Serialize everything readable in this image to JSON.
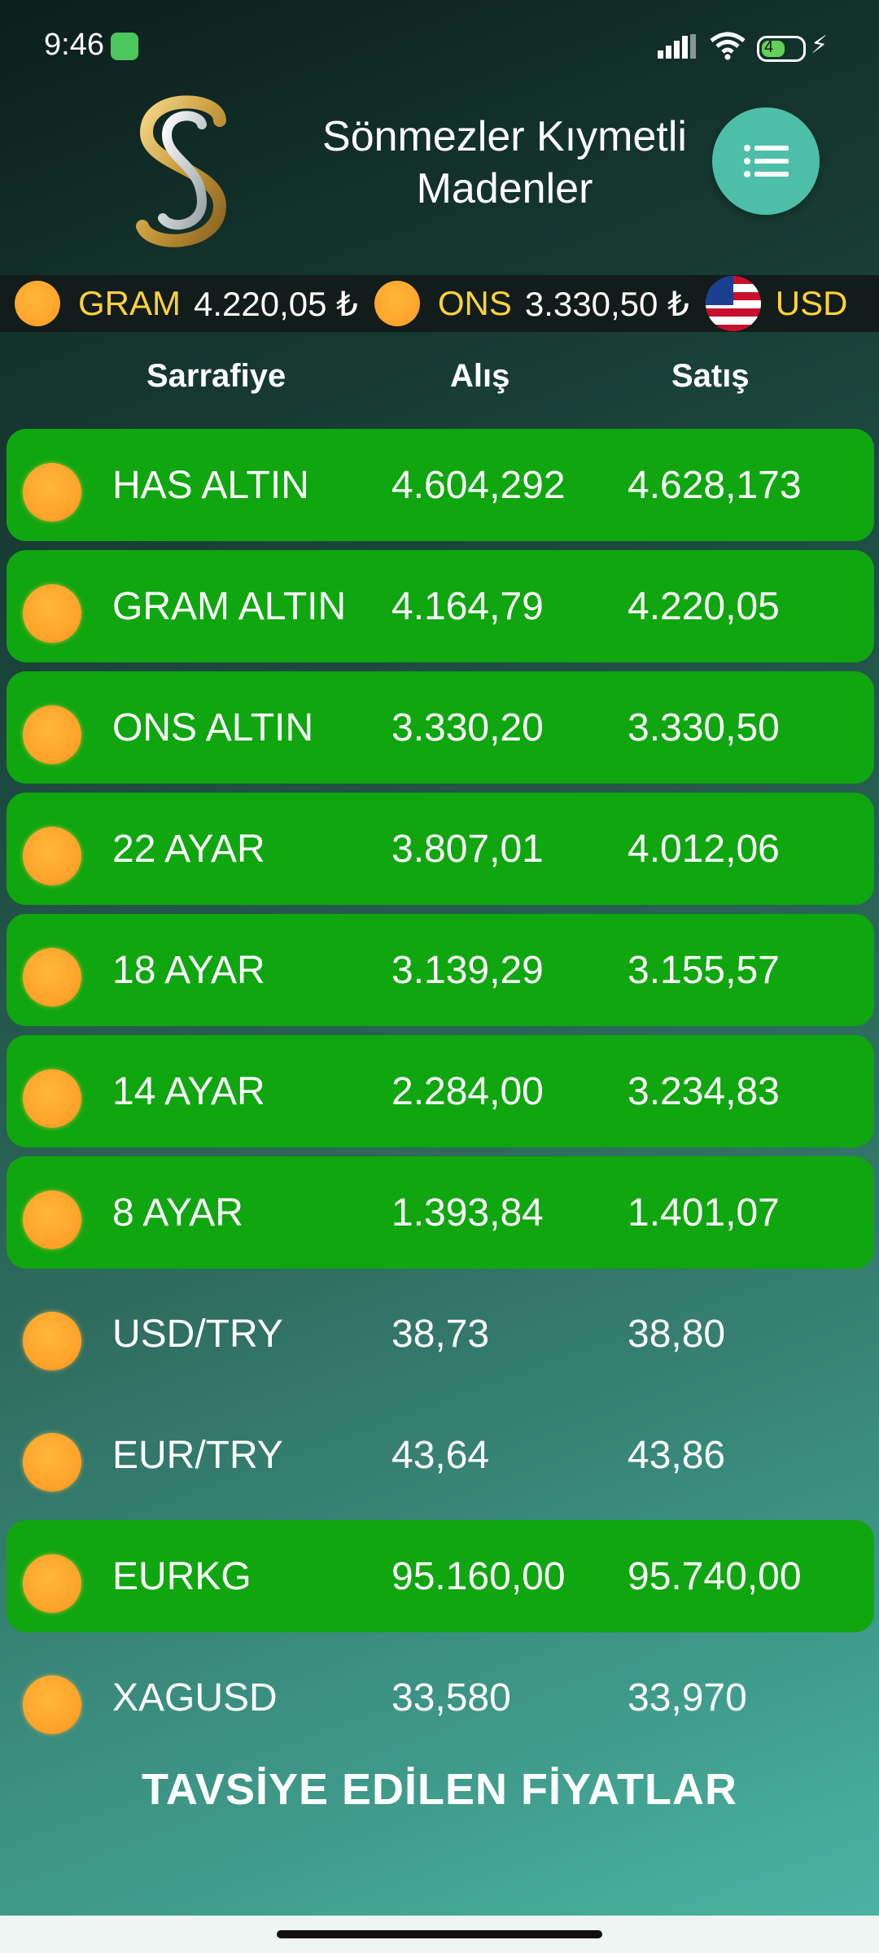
{
  "status_bar": {
    "time": "9:46",
    "battery": "4"
  },
  "header": {
    "title_line1": "Sönmezler Kıymetli",
    "title_line2": "Madenler",
    "menu_icon": "list-icon"
  },
  "ticker": {
    "items": [
      {
        "name": "GRAM",
        "value": "4.220,05 ₺"
      },
      {
        "name": "ONS",
        "value": "3.330,50 ₺"
      },
      {
        "name": "USD",
        "value": ""
      }
    ]
  },
  "table": {
    "headers": {
      "name": "Sarrafiye",
      "buy": "Alış",
      "sell": "Satış"
    },
    "rows": [
      {
        "name": "HAS ALTIN",
        "buy": "4.604,292",
        "sell": "4.628,173"
      },
      {
        "name": "GRAM ALTIN",
        "buy": "4.164,79",
        "sell": "4.220,05"
      },
      {
        "name": "ONS ALTIN",
        "buy": "3.330,20",
        "sell": "3.330,50"
      },
      {
        "name": "22 AYAR",
        "buy": "3.807,01",
        "sell": "4.012,06"
      },
      {
        "name": "18 AYAR",
        "buy": "3.139,29",
        "sell": "3.155,57"
      },
      {
        "name": "14 AYAR",
        "buy": "2.284,00",
        "sell": "3.234,83"
      },
      {
        "name": "8 AYAR",
        "buy": "1.393,84",
        "sell": "1.401,07"
      },
      {
        "name": "USD/TRY",
        "buy": "38,73",
        "sell": "38,80"
      },
      {
        "name": "EUR/TRY",
        "buy": "43,64",
        "sell": "43,86"
      },
      {
        "name": "EURKG",
        "buy": "95.160,00",
        "sell": "95.740,00"
      },
      {
        "name": "XAGUSD",
        "buy": "33,580",
        "sell": "33,970"
      }
    ]
  },
  "footer": {
    "title": "TAVSİYE EDİLEN FİYATLAR"
  },
  "colors": {
    "highlight_row": "#0fa60f",
    "menu_button": "#4dbfa9",
    "ticker_label": "#ffd23b",
    "coin": "#ffa32a"
  }
}
